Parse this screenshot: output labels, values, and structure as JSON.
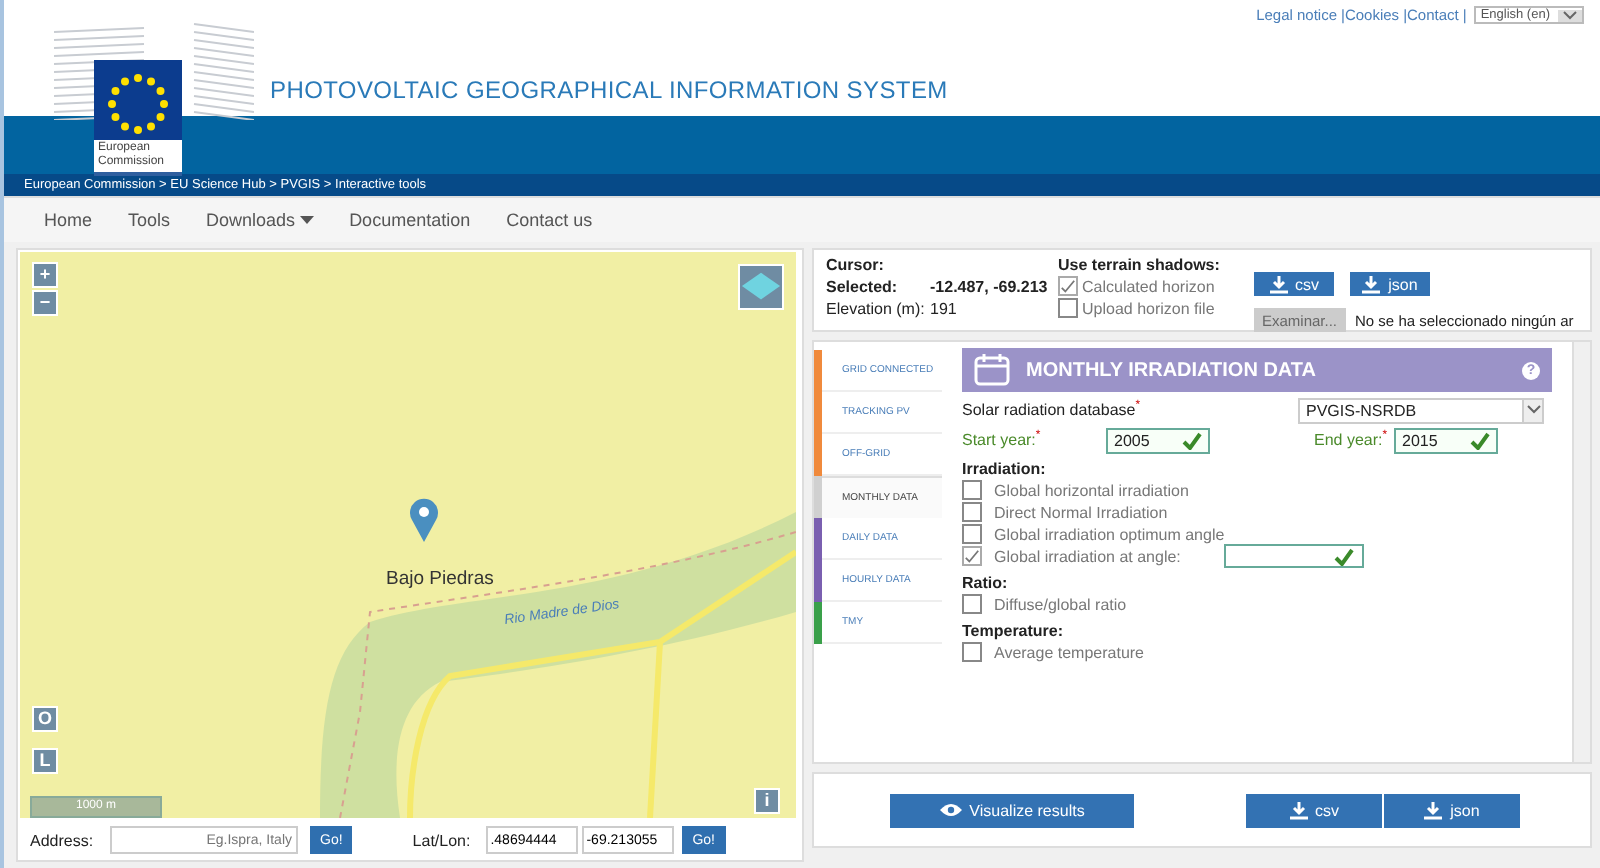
{
  "top_links": [
    "Legal notice",
    "|Cookies",
    "|Contact",
    "|"
  ],
  "language": {
    "value": "English (en)"
  },
  "logo": {
    "caption": [
      "European",
      "Commission"
    ]
  },
  "site_title": "PHOTOVOLTAIC GEOGRAPHICAL INFORMATION SYSTEM",
  "breadcrumb": "European Commission > EU Science Hub > PVGIS > Interactive tools",
  "nav": [
    {
      "label": "Home",
      "dropdown": false
    },
    {
      "label": "Tools",
      "dropdown": false
    },
    {
      "label": "Downloads",
      "dropdown": true
    },
    {
      "label": "Documentation",
      "dropdown": false
    },
    {
      "label": "Contact us",
      "dropdown": false
    }
  ],
  "map": {
    "zoom_in": "+",
    "zoom_out": "−",
    "place": "Bajo Piedras",
    "river": "Rio Madre de Dios",
    "btn_o": "O",
    "btn_l": "L",
    "scale": "1000 m",
    "info": "i"
  },
  "address": {
    "label": "Address:",
    "placeholder": "Eg.Ispra, Italy",
    "go": "Go!"
  },
  "latlon": {
    "label": "Lat/Lon:",
    "lat": ".48694444",
    "lon": "-69.213055",
    "go": "Go!"
  },
  "cursor": {
    "label": "Cursor:",
    "selected_label": "Selected:",
    "selected_value": "-12.487, -69.213",
    "elevation_label": "Elevation (m):",
    "elevation_value": "191"
  },
  "shadows": {
    "title": "Use terrain shadows:",
    "options": [
      {
        "label": "Calculated horizon",
        "checked": true
      },
      {
        "label": "Upload horizon file",
        "checked": false
      }
    ]
  },
  "top_downloads": [
    "csv",
    "json"
  ],
  "file": {
    "button": "Examinar...",
    "status": "No se ha seleccionado ningún ar"
  },
  "tabs": [
    {
      "label": "GRID CONNECTED",
      "color": "#f08a3c",
      "selected": false
    },
    {
      "label": "TRACKING PV",
      "color": "#f08a3c",
      "selected": false
    },
    {
      "label": "OFF-GRID",
      "color": "#f08a3c",
      "selected": false
    },
    {
      "label": "MONTHLY DATA",
      "color": "#d0d0d0",
      "selected": true
    },
    {
      "label": "DAILY DATA",
      "color": "#7a5fb0",
      "selected": false
    },
    {
      "label": "HOURLY DATA",
      "color": "#7a5fb0",
      "selected": false
    },
    {
      "label": "TMY",
      "color": "#3aa04a",
      "selected": false
    }
  ],
  "panel": {
    "title": "MONTHLY IRRADIATION DATA",
    "help": "?",
    "database_label": "Solar radiation database$^{*}$",
    "database_value": "PVGIS-NSRDB",
    "start_label": "Start year:$^{*}$",
    "start_value": "2005",
    "end_label": "End year:$^{*}$",
    "end_value": "2015",
    "groups": [
      {
        "title": "Irradiation:",
        "items": [
          {
            "label": "Global horizontal irradiation",
            "checked": false,
            "kind": "plain"
          },
          {
            "label": "Direct Normal Irradiation",
            "checked": false,
            "kind": "plain"
          },
          {
            "label": "Global irradiation optimum angle",
            "checked": false,
            "kind": "plain"
          },
          {
            "label": "Global irradiation at angle:",
            "checked": true,
            "kind": "angle"
          }
        ]
      },
      {
        "title": "Ratio:",
        "items": [
          {
            "label": "Diffuse/global ratio",
            "checked": false,
            "kind": "plain"
          }
        ]
      },
      {
        "title": "Temperature:",
        "items": [
          {
            "label": "Average temperature",
            "checked": false,
            "kind": "plain"
          }
        ]
      }
    ]
  },
  "visualize": "Visualize results",
  "bottom_downloads": [
    "csv",
    "json"
  ]
}
